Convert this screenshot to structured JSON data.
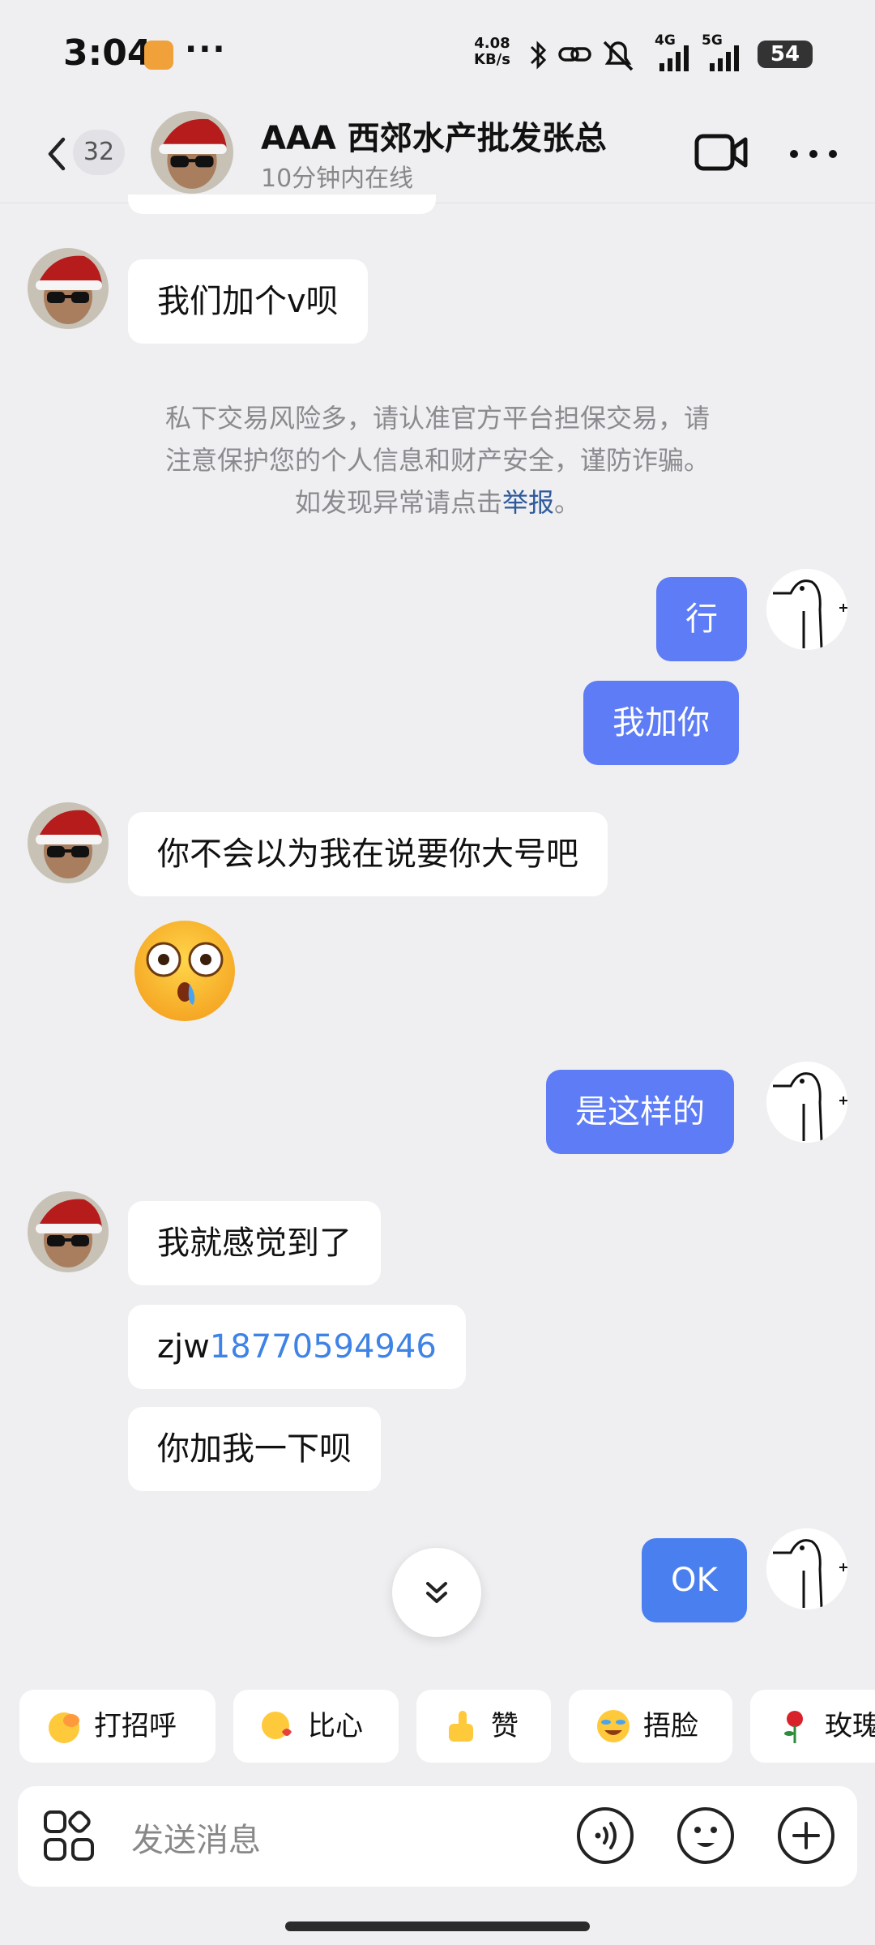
{
  "status_bar": {
    "time": "3:04",
    "more": "···",
    "speed_value": "4.08",
    "speed_unit": "KB/s",
    "network_1": "4G",
    "network_2": "5G",
    "battery": "54"
  },
  "header": {
    "unread_count": "32",
    "contact_name": "AAA 西郊水产批发张总",
    "contact_status": "10分钟内在线"
  },
  "messages": {
    "m1": "我们加个v呗",
    "m2": "行",
    "m3": "我加你",
    "m4": "你不会以为我在说要你大号吧",
    "m5": "是这样的",
    "m6": "我就感觉到了",
    "m7_prefix": "zjw",
    "m7_link": "18770594946",
    "m8": "你加我一下呗",
    "m9": "OK"
  },
  "notice": {
    "text": "私下交易风险多，请认准官方平台担保交易，请注意保护您的个人信息和财产安全，谨防诈骗。如发现异常请点击",
    "report": "举报",
    "end": "。"
  },
  "quick_replies": [
    {
      "label": "打招呼",
      "icon": "wave-hand-emoji"
    },
    {
      "label": "比心",
      "icon": "heart-hands-emoji"
    },
    {
      "label": "赞",
      "icon": "thumbs-up-emoji"
    },
    {
      "label": "捂脸",
      "icon": "facepalm-emoji"
    },
    {
      "label": "玫瑰",
      "icon": "rose-emoji"
    }
  ],
  "input": {
    "placeholder": "发送消息"
  },
  "colors": {
    "outgoing_bubble": "#5d7cf5",
    "link": "#3f83e6",
    "background": "#efeff1"
  }
}
